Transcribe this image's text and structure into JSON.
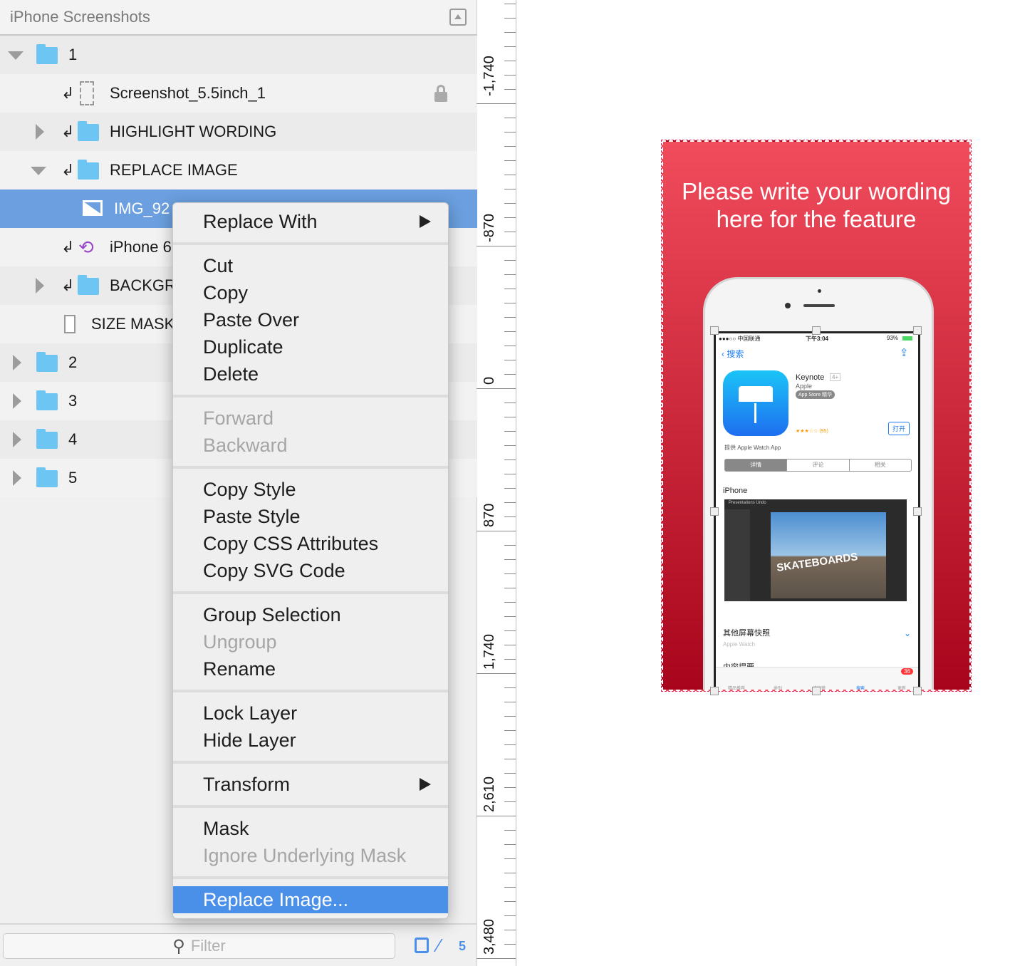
{
  "panel": {
    "title": "iPhone Screenshots",
    "layers": [
      {
        "name": "1"
      },
      {
        "name": "Screenshot_5.5inch_1"
      },
      {
        "name": "HIGHLIGHT WORDING"
      },
      {
        "name": "REPLACE IMAGE"
      },
      {
        "name": "IMG_92"
      },
      {
        "name": "iPhone 6"
      },
      {
        "name": "BACKGR"
      },
      {
        "name": "SIZE MASK"
      },
      {
        "name": "2"
      },
      {
        "name": "3"
      },
      {
        "name": "4"
      },
      {
        "name": "5"
      }
    ],
    "filter_placeholder": "Filter",
    "count": "5"
  },
  "menu": {
    "items": [
      "Replace With",
      "Cut",
      "Copy",
      "Paste Over",
      "Duplicate",
      "Delete",
      "Forward",
      "Backward",
      "Copy Style",
      "Paste Style",
      "Copy CSS Attributes",
      "Copy SVG Code",
      "Group Selection",
      "Ungroup",
      "Rename",
      "Lock Layer",
      "Hide Layer",
      "Transform",
      "Mask",
      "Ignore Underlying Mask",
      "Replace Image..."
    ]
  },
  "ruler": {
    "labels": [
      "-1,740",
      "-870",
      "0",
      "870",
      "1,740",
      "2,610",
      "3,480"
    ]
  },
  "artboard": {
    "headline": "Please write your wording here for the feature",
    "app": {
      "carrier": "●●●○○ 中国联通",
      "time": "下午3:04",
      "battery": "93%",
      "back": "搜索",
      "name": "Keynote",
      "age": "4+",
      "dev": "Apple",
      "badge": "App Store 精华",
      "rating": "★★★☆☆ (95)",
      "open": "打开",
      "watch": "提供 Apple Watch App",
      "tabs": [
        "详情",
        "评论",
        "相关"
      ],
      "section": "iPhone",
      "toolbar": "Presentations   Undo",
      "slide": "SKATEBOARDS",
      "more": "其他屏幕快照",
      "more_sub": "Apple Watch",
      "next": "内容提要",
      "tabbar": [
        "精品推荐",
        "类别",
        "排行榜",
        "搜索",
        "更新"
      ],
      "updates": "36"
    }
  },
  "colors": {
    "selection": "#6b9fdf",
    "menu_highlight": "#4a90e8",
    "artboard_top": "#f04c5c",
    "artboard_bottom": "#a8051c"
  }
}
